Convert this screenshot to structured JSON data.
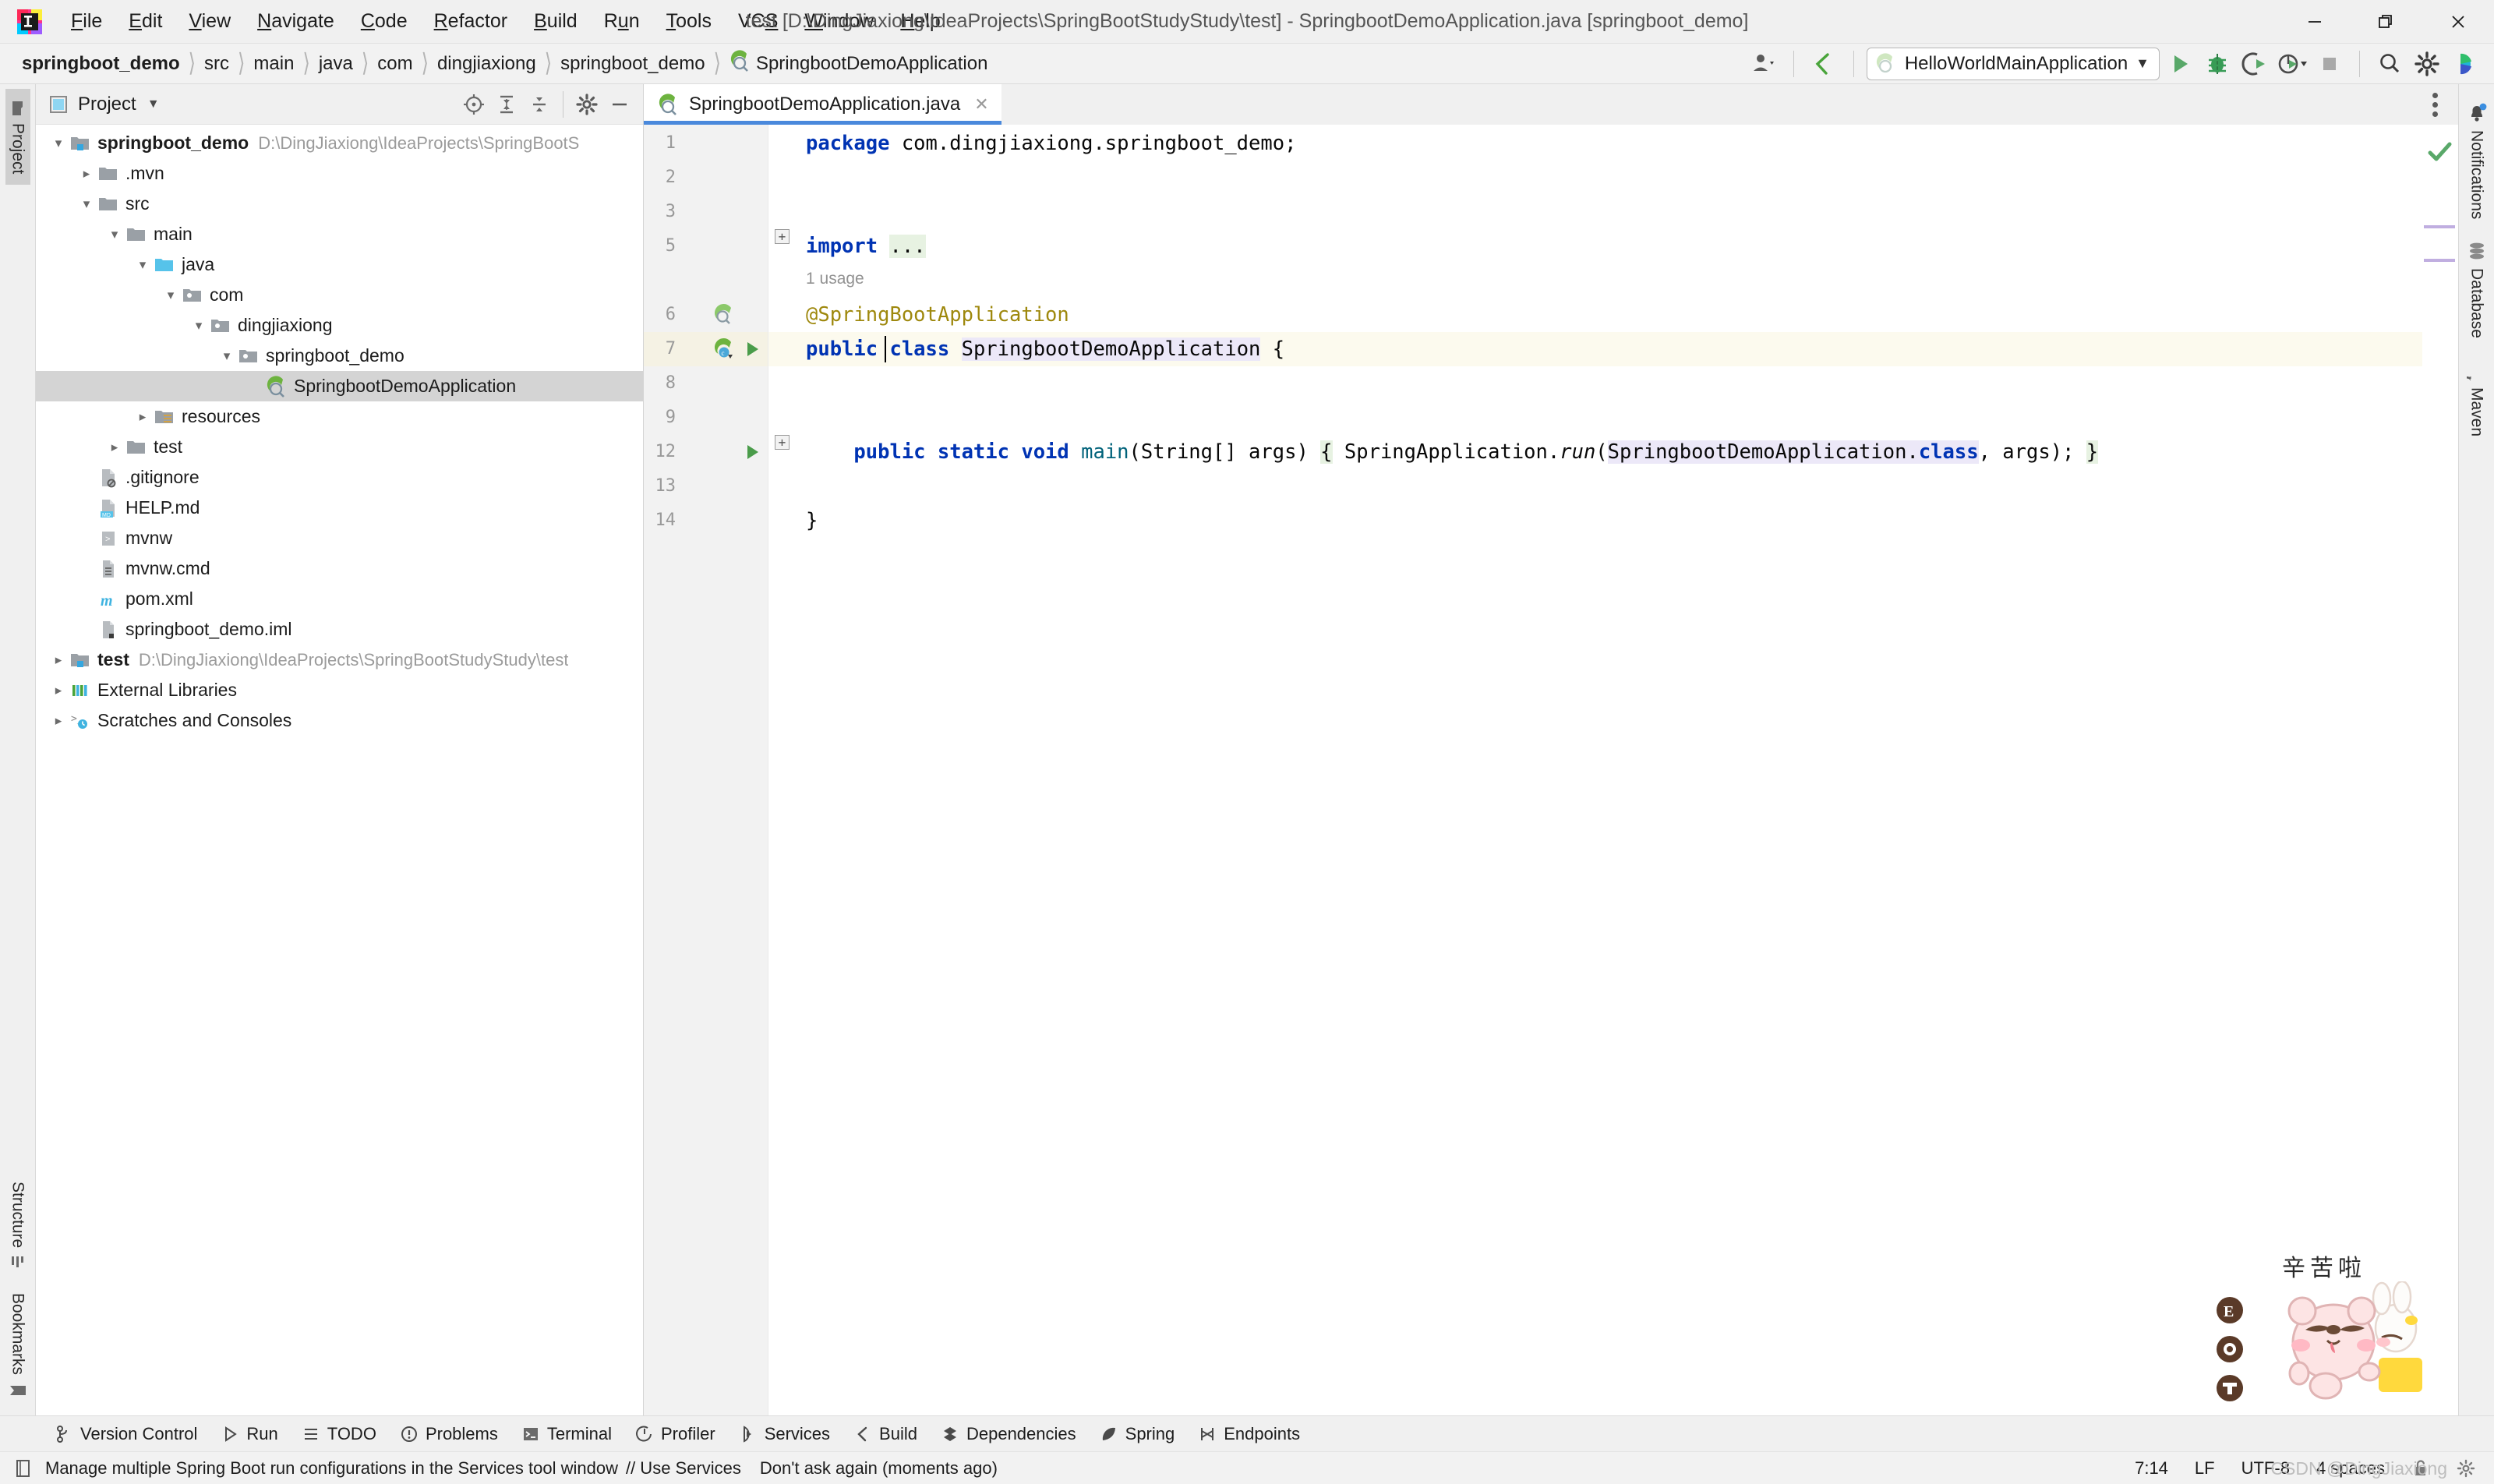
{
  "window": {
    "title": "test [D:\\DingJiaxiong\\IdeaProjects\\SpringBootStudyStudy\\test] - SpringbootDemoApplication.java [springboot_demo]",
    "minimize_label": "—",
    "restore_label": "❐",
    "close_label": "✕"
  },
  "menu": [
    {
      "pre": "",
      "u": "F",
      "post": "ile",
      "name": "file"
    },
    {
      "pre": "",
      "u": "E",
      "post": "dit",
      "name": "edit"
    },
    {
      "pre": "",
      "u": "V",
      "post": "iew",
      "name": "view"
    },
    {
      "pre": "",
      "u": "N",
      "post": "avigate",
      "name": "navigate"
    },
    {
      "pre": "",
      "u": "C",
      "post": "ode",
      "name": "code"
    },
    {
      "pre": "",
      "u": "R",
      "post": "efactor",
      "name": "refactor"
    },
    {
      "pre": "",
      "u": "B",
      "post": "uild",
      "name": "build"
    },
    {
      "pre": "R",
      "u": "u",
      "post": "n",
      "name": "run"
    },
    {
      "pre": "",
      "u": "T",
      "post": "ools",
      "name": "tools"
    },
    {
      "pre": "VC",
      "u": "S",
      "post": "",
      "name": "vcs"
    },
    {
      "pre": "",
      "u": "W",
      "post": "indow",
      "name": "window"
    },
    {
      "pre": "",
      "u": "H",
      "post": "elp",
      "name": "help"
    }
  ],
  "breadcrumbs": [
    {
      "label": "springboot_demo",
      "bold": true,
      "icon": "none"
    },
    {
      "label": "src",
      "bold": false,
      "icon": "none"
    },
    {
      "label": "main",
      "bold": false,
      "icon": "none"
    },
    {
      "label": "java",
      "bold": false,
      "icon": "none"
    },
    {
      "label": "com",
      "bold": false,
      "icon": "none"
    },
    {
      "label": "dingjiaxiong",
      "bold": false,
      "icon": "none"
    },
    {
      "label": "springboot_demo",
      "bold": false,
      "icon": "none"
    },
    {
      "label": "SpringbootDemoApplication",
      "bold": false,
      "icon": "spring-class-icon"
    }
  ],
  "toolbar": {
    "run_config": "HelloWorldMainApplication",
    "run_config_icon": "spring-boot-icon",
    "dropdown_caret": "▼",
    "icons": [
      "user-avatar-icon",
      "build-arrow-icon",
      "run-icon",
      "debug-icon",
      "run-with-coverage-icon",
      "profiler-icon",
      "stop-icon",
      "search-everywhere-icon",
      "settings-gear-icon",
      "ide-assistant-icon"
    ]
  },
  "left_rail": {
    "top": [
      {
        "label": "Project",
        "active": true,
        "icon": "project-icon"
      }
    ],
    "bottom": [
      {
        "label": "Structure",
        "active": false,
        "icon": "structure-icon"
      },
      {
        "label": "Bookmarks",
        "active": false,
        "icon": "bookmarks-icon"
      }
    ]
  },
  "right_rail": [
    {
      "label": "Notifications",
      "icon": "bell-icon",
      "badge": true
    },
    {
      "label": "Database",
      "icon": "database-icon",
      "badge": false
    },
    {
      "label": "Maven",
      "icon": "maven-m-icon",
      "badge": false
    }
  ],
  "project_panel": {
    "title": "Project",
    "caret": "▼",
    "tool_icons": [
      "locate-icon",
      "expand-all-icon",
      "collapse-all-icon",
      "gear-icon",
      "hide-icon"
    ],
    "tree": [
      {
        "indent": 0,
        "arrow": "v",
        "icon": "module-root-icon",
        "label": "springboot_demo",
        "bold": true,
        "path": "D:\\DingJiaxiong\\IdeaProjects\\SpringBootS",
        "selected": false
      },
      {
        "indent": 1,
        "arrow": ">",
        "icon": "folder-icon",
        "label": ".mvn",
        "bold": false,
        "path": "",
        "selected": false
      },
      {
        "indent": 1,
        "arrow": "v",
        "icon": "folder-icon",
        "label": "src",
        "bold": false,
        "path": "",
        "selected": false
      },
      {
        "indent": 2,
        "arrow": "v",
        "icon": "folder-icon",
        "label": "main",
        "bold": false,
        "path": "",
        "selected": false
      },
      {
        "indent": 3,
        "arrow": "v",
        "icon": "source-folder-icon",
        "label": "java",
        "bold": false,
        "path": "",
        "selected": false
      },
      {
        "indent": 4,
        "arrow": "v",
        "icon": "package-icon",
        "label": "com",
        "bold": false,
        "path": "",
        "selected": false
      },
      {
        "indent": 5,
        "arrow": "v",
        "icon": "package-icon",
        "label": "dingjiaxiong",
        "bold": false,
        "path": "",
        "selected": false
      },
      {
        "indent": 6,
        "arrow": "v",
        "icon": "package-icon",
        "label": "springboot_demo",
        "bold": false,
        "path": "",
        "selected": false
      },
      {
        "indent": 7,
        "arrow": "",
        "icon": "spring-class-icon",
        "label": "SpringbootDemoApplication",
        "bold": false,
        "path": "",
        "selected": true
      },
      {
        "indent": 3,
        "arrow": ">",
        "icon": "resources-folder-icon",
        "label": "resources",
        "bold": false,
        "path": "",
        "selected": false
      },
      {
        "indent": 2,
        "arrow": ">",
        "icon": "folder-icon",
        "label": "test",
        "bold": false,
        "path": "",
        "selected": false
      },
      {
        "indent": 1,
        "arrow": "",
        "icon": "gitignore-file-icon",
        "label": ".gitignore",
        "bold": false,
        "path": "",
        "selected": false
      },
      {
        "indent": 1,
        "arrow": "",
        "icon": "markdown-file-icon",
        "label": "HELP.md",
        "bold": false,
        "path": "",
        "selected": false
      },
      {
        "indent": 1,
        "arrow": "",
        "icon": "script-file-icon",
        "label": "mvnw",
        "bold": false,
        "path": "",
        "selected": false
      },
      {
        "indent": 1,
        "arrow": "",
        "icon": "cmd-file-icon",
        "label": "mvnw.cmd",
        "bold": false,
        "path": "",
        "selected": false
      },
      {
        "indent": 1,
        "arrow": "",
        "icon": "maven-m-icon",
        "label": "pom.xml",
        "bold": false,
        "path": "",
        "selected": false
      },
      {
        "indent": 1,
        "arrow": "",
        "icon": "iml-file-icon",
        "label": "springboot_demo.iml",
        "bold": false,
        "path": "",
        "selected": false
      },
      {
        "indent": 0,
        "arrow": ">",
        "icon": "module-root-icon",
        "label": "test",
        "bold": true,
        "path": "D:\\DingJiaxiong\\IdeaProjects\\SpringBootStudyStudy\\test",
        "selected": false
      },
      {
        "indent": 0,
        "arrow": ">",
        "icon": "external-libraries-icon",
        "label": "External Libraries",
        "bold": false,
        "path": "",
        "selected": false
      },
      {
        "indent": 0,
        "arrow": ">",
        "icon": "scratches-icon",
        "label": "Scratches and Consoles",
        "bold": false,
        "path": "",
        "selected": false
      }
    ]
  },
  "editor": {
    "tab": {
      "label": "SpringbootDemoApplication.java",
      "icon": "spring-class-icon",
      "close": "✕"
    },
    "usage_hint": "1 usage",
    "line_numbers": [
      "1",
      "2",
      "3",
      "5",
      "6",
      "7",
      "8",
      "9",
      "12",
      "13",
      "14"
    ],
    "code": {
      "l1_kw": "package",
      "l1_rest": " com.dingjiaxiong.springboot_demo;",
      "l3_kw": "import",
      "l3_dots": "...",
      "l6_annotation": "@SpringBootApplication",
      "l7_a": "public class ",
      "l7_class": "SpringbootDemoApplication",
      "l7_b": " {",
      "l9_a": "    public static void ",
      "l9_main": "main",
      "l9_b": "(String[] args) ",
      "l9_brace_open": "{",
      "l9_c": " SpringApplication.",
      "l9_run": "run",
      "l9_d": "(",
      "l9_cls": "SpringbootDemoApplication",
      "l9_dot": ".",
      "l9_classkw": "class",
      "l9_e": ", args); ",
      "l9_brace_close": "}",
      "l13_brace": "}"
    }
  },
  "toolwindow_bar": [
    {
      "label": "Version Control",
      "icon": "version-control-icon"
    },
    {
      "label": "Run",
      "icon": "run-icon"
    },
    {
      "label": "TODO",
      "icon": "todo-icon"
    },
    {
      "label": "Problems",
      "icon": "problems-icon"
    },
    {
      "label": "Terminal",
      "icon": "terminal-icon"
    },
    {
      "label": "Profiler",
      "icon": "profiler-icon"
    },
    {
      "label": "Services",
      "icon": "services-icon"
    },
    {
      "label": "Build",
      "icon": "build-icon"
    },
    {
      "label": "Dependencies",
      "icon": "dependencies-icon"
    },
    {
      "label": "Spring",
      "icon": "spring-leaf-icon"
    },
    {
      "label": "Endpoints",
      "icon": "endpoints-icon"
    }
  ],
  "statusbar": {
    "icon": "event-log-icon",
    "message": "Manage multiple Spring Boot run configurations in the Services tool window",
    "link": "// Use Services",
    "dismiss": "Don't ask again (moments ago)",
    "position": "7:14",
    "line_separator": "LF",
    "encoding": "UTF-8",
    "indent": "4 spaces",
    "lock_icon": "unlocked-icon",
    "gear_icon": "settings-gear-icon"
  },
  "watermark": {
    "sticker_text": "辛苦啦",
    "csdn": "CSDN @DingJiaxiong",
    "badges": [
      "E",
      "✿",
      "T"
    ]
  },
  "colors": {
    "accent_blue": "#4a89dc",
    "keyword": "#0033b3",
    "annotation": "#9e880d",
    "method": "#00627a",
    "caret_row": "#fcfaee",
    "selection_green": "#e7f2e2",
    "identifier_hl": "#ece8f8",
    "tree_selection": "#d4d4d4",
    "spring_green": "#6db33f"
  }
}
